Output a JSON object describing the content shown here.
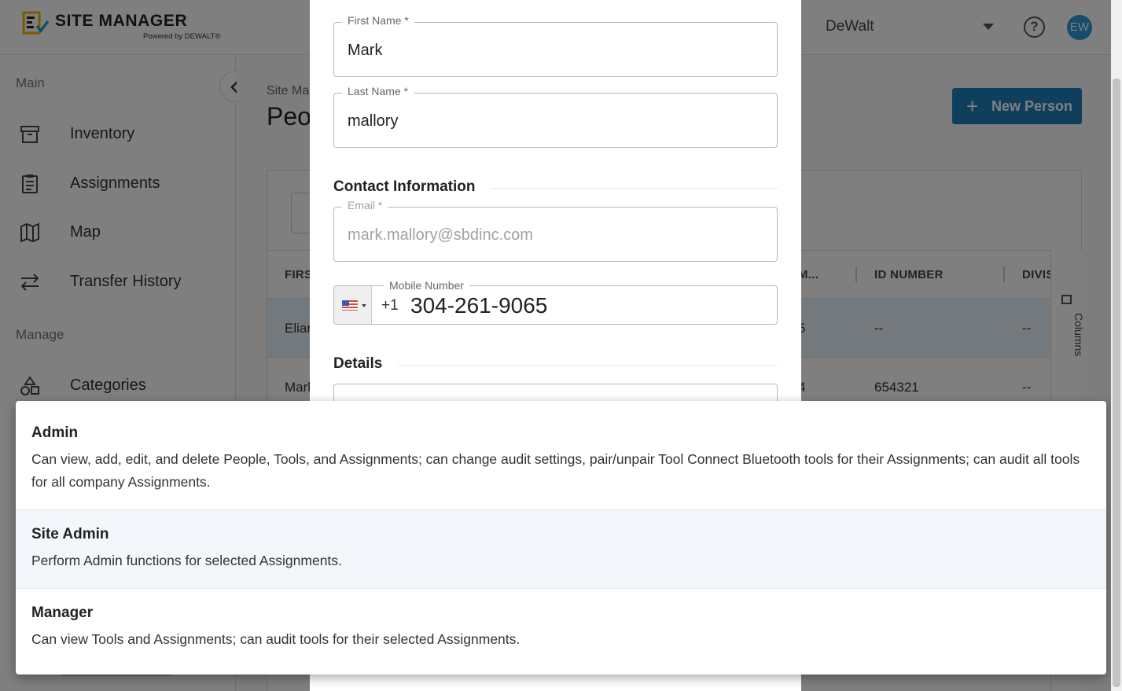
{
  "header": {
    "logo_title": "SITE MANAGER",
    "logo_subtitle": "Powered by DEWALT®",
    "org_name": "DeWalt",
    "avatar_initials": "EW"
  },
  "sidebar": {
    "main_heading": "Main",
    "manage_heading": "Manage",
    "items": [
      {
        "label": "Inventory",
        "icon": "archive-box-icon"
      },
      {
        "label": "Assignments",
        "icon": "clipboard-icon"
      },
      {
        "label": "Map",
        "icon": "map-icon"
      },
      {
        "label": "Transfer History",
        "icon": "transfer-arrows-icon"
      },
      {
        "label": "Categories",
        "icon": "shapes-icon"
      }
    ]
  },
  "main": {
    "breadcrumb": "Site Ma",
    "title": "Peop",
    "new_button": "New Person",
    "table": {
      "headers": [
        "FIRS",
        "M...",
        "ID NUMBER",
        "DIVIS"
      ],
      "rows": [
        [
          "Elian",
          "5",
          "--",
          "--"
        ],
        [
          "Marl",
          "4",
          "654321",
          "--"
        ]
      ],
      "columns_label": "Columns"
    }
  },
  "modal": {
    "first_name_label": "First Name *",
    "first_name_value": "Mark",
    "last_name_label": "Last Name *",
    "last_name_value": "mallory",
    "contact_section": "Contact Information",
    "email_label": "Email *",
    "email_value": "mark.mallory@sbdinc.com",
    "mobile_label": "Mobile Number",
    "dial_code": "+1",
    "mobile_value": "304-261-9065",
    "details_section": "Details"
  },
  "role_options": [
    {
      "title": "Admin",
      "description": "Can view, add, edit, and delete People, Tools, and Assignments; can change audit settings, pair/unpair Tool Connect Bluetooth tools for their Assignments; can audit all tools for all company Assignments."
    },
    {
      "title": "Site Admin",
      "description": "Perform Admin functions for selected Assignments."
    },
    {
      "title": "Manager",
      "description": "Can view Tools and Assignments; can audit tools for their selected Assignments."
    }
  ],
  "colors": {
    "accent": "#1f7fba",
    "avatar": "#2a9ad8",
    "logo_yellow": "#f2b705"
  }
}
